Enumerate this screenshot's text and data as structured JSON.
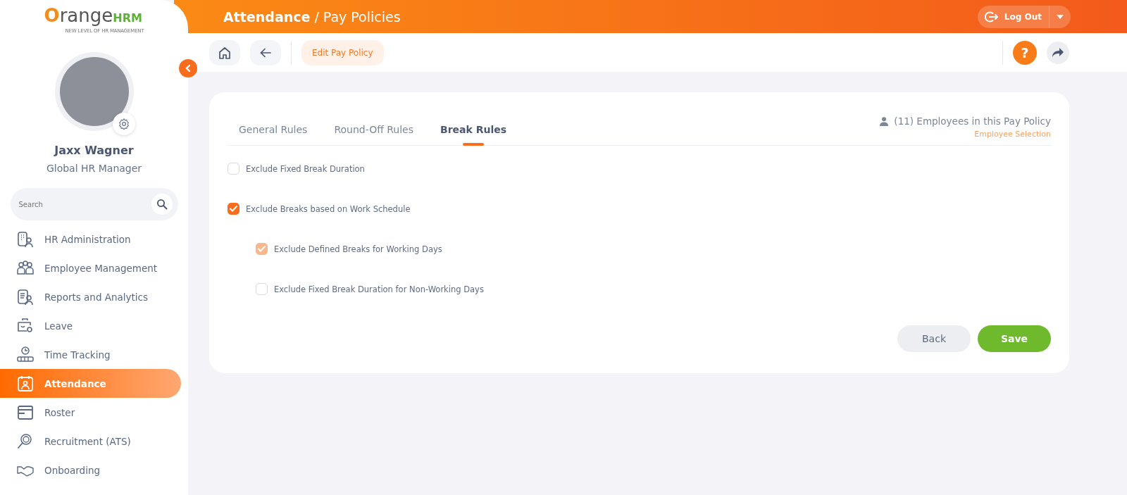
{
  "logo": {
    "initial": "O",
    "word": "range",
    "suffix": "HRM",
    "tagline": "NEW LEVEL OF HR MANAGEMENT"
  },
  "user": {
    "name": "Jaxx Wagner",
    "role": "Global HR Manager"
  },
  "search": {
    "placeholder": "Search"
  },
  "menu": [
    {
      "label": "HR Administration",
      "selected": false
    },
    {
      "label": "Employee Management",
      "selected": false
    },
    {
      "label": "Reports and Analytics",
      "selected": false
    },
    {
      "label": "Leave",
      "selected": false
    },
    {
      "label": "Time Tracking",
      "selected": false
    },
    {
      "label": "Attendance",
      "selected": true
    },
    {
      "label": "Roster",
      "selected": false
    },
    {
      "label": "Recruitment (ATS)",
      "selected": false
    },
    {
      "label": "Onboarding",
      "selected": false
    }
  ],
  "header": {
    "module": "Attendance",
    "separator": "/",
    "page": "Pay Policies",
    "logout": "Log Out"
  },
  "toolbar": {
    "page_button": "Edit Pay Policy",
    "help": "?"
  },
  "tabs": [
    {
      "label": "General Rules",
      "selected": false
    },
    {
      "label": "Round-Off Rules",
      "selected": false
    },
    {
      "label": "Break Rules",
      "selected": true
    }
  ],
  "employees": {
    "count_text": "(11) Employees in this Pay Policy",
    "link": "Employee Selection"
  },
  "options": [
    {
      "label": "Exclude Fixed Break Duration",
      "checked": false,
      "disabled": false
    },
    {
      "label": "Exclude Breaks based on Work Schedule",
      "checked": true,
      "disabled": false,
      "children": [
        {
          "label": "Exclude Defined Breaks for Working Days",
          "checked": true,
          "disabled": true
        },
        {
          "label": "Exclude Fixed Break Duration for Non-Working Days",
          "checked": false,
          "disabled": false
        }
      ]
    }
  ],
  "buttons": [
    {
      "label": "Back",
      "kind": "secondary"
    },
    {
      "label": "Save",
      "kind": "primary"
    }
  ]
}
